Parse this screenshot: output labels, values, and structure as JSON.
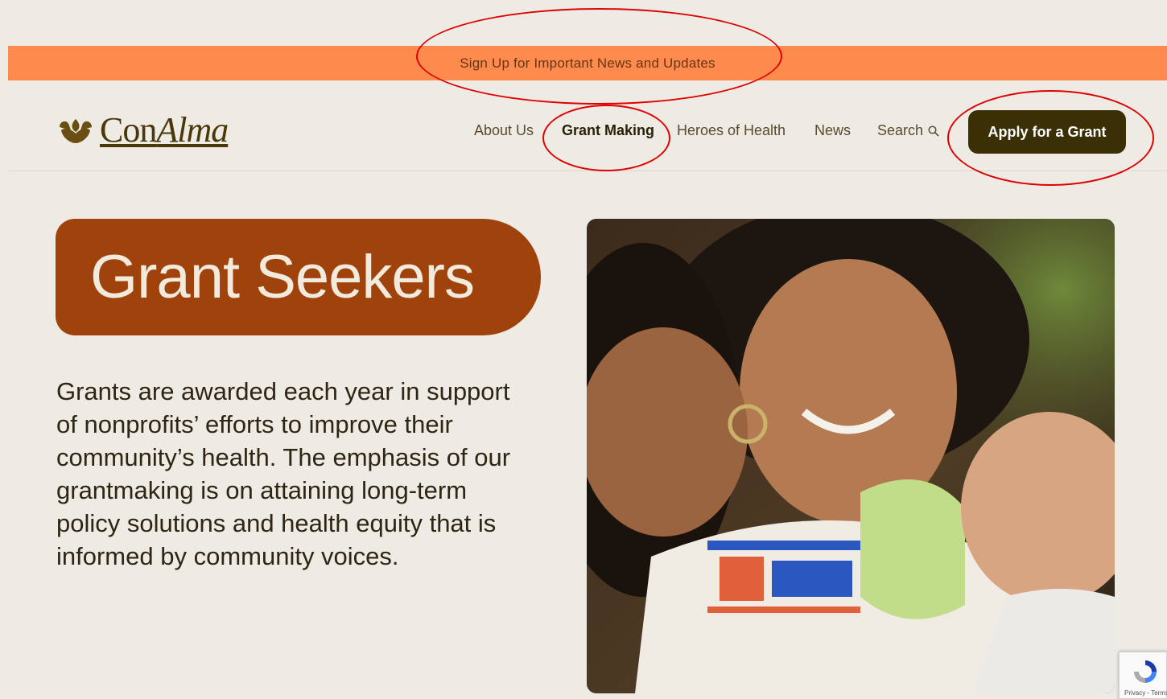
{
  "announcement": {
    "text": "Sign Up for Important News and Updates"
  },
  "header": {
    "logo": {
      "con": "Con",
      "alma": "Alma"
    },
    "nav": [
      {
        "label": "About Us"
      },
      {
        "label": "Grant Making",
        "active": true
      },
      {
        "label": "Heroes of Health"
      },
      {
        "label": "News"
      },
      {
        "label": "Search"
      }
    ],
    "cta_label": "Apply for a Grant"
  },
  "hero": {
    "title": "Grant Seekers",
    "body": "Grants are awarded each year in support of nonprofits’ efforts to improve their community’s health. The emphasis of our grantmaking is on attaining long-term policy solutions and health equity that is informed by community voices."
  },
  "recaptcha": {
    "terms": "Privacy - Terms"
  },
  "colors": {
    "background": "#EEEBE5",
    "announcement_bar": "#FC8B4D",
    "title_pill": "#A0420B",
    "cta": "#3B2F05",
    "annotation": "#E00000"
  }
}
